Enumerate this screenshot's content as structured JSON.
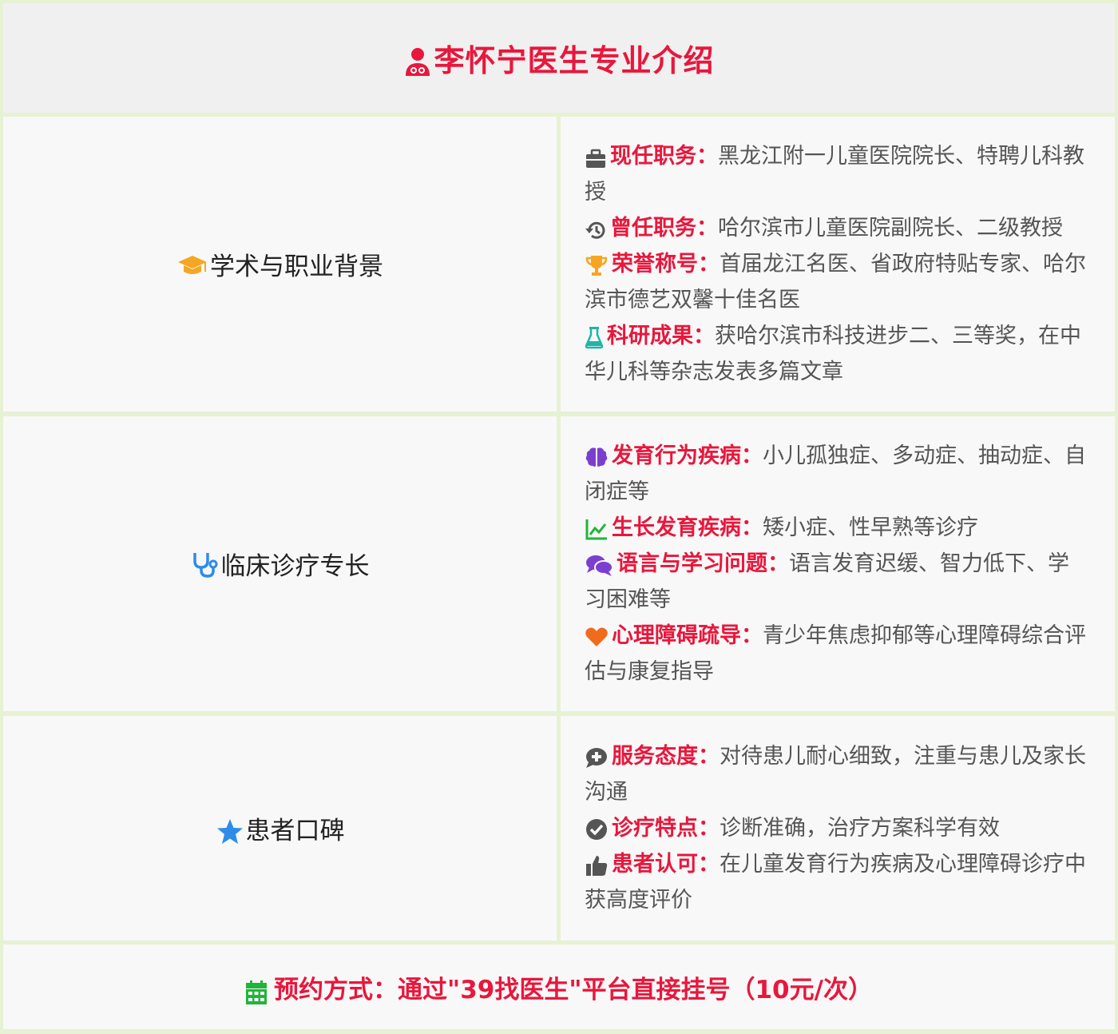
{
  "header": {
    "title": "李怀宁医生专业介绍",
    "icon": "doctor-icon",
    "color": "#e8173c"
  },
  "sections": [
    {
      "category": "学术与职业背景",
      "category_icon": "graduation-cap-icon",
      "items": [
        {
          "icon": "briefcase-icon",
          "label": "现任职务：",
          "text": "黑龙江附一儿童医院院长、特聘儿科教授"
        },
        {
          "icon": "history-icon",
          "label": "曾任职务：",
          "text": "哈尔滨市儿童医院副院长、二级教授"
        },
        {
          "icon": "trophy-icon",
          "label": "荣誉称号：",
          "text": "首届龙江名医、省政府特贴专家、哈尔滨市德艺双馨十佳名医"
        },
        {
          "icon": "flask-icon",
          "label": "科研成果：",
          "text": "获哈尔滨市科技进步二、三等奖，在中华儿科等杂志发表多篇文章"
        }
      ]
    },
    {
      "category": "临床诊疗专长",
      "category_icon": "stethoscope-icon",
      "items": [
        {
          "icon": "brain-icon",
          "label": "发育行为疾病：",
          "text": "小儿孤独症、多动症、抽动症、自闭症等"
        },
        {
          "icon": "chart-line-icon",
          "label": "生长发育疾病：",
          "text": "矮小症、性早熟等诊疗"
        },
        {
          "icon": "comments-icon",
          "label": "语言与学习问题：",
          "text": "语言发育迟缓、智力低下、学习困难等"
        },
        {
          "icon": "heart-icon",
          "label": "心理障碍疏导：",
          "text": "青少年焦虑抑郁等心理障碍综合评估与康复指导"
        }
      ]
    },
    {
      "category": "患者口碑",
      "category_icon": "star-icon",
      "items": [
        {
          "icon": "comment-medical-icon",
          "label": "服务态度：",
          "text": "对待患儿耐心细致，注重与患儿及家长沟通"
        },
        {
          "icon": "check-circle-icon",
          "label": "诊疗特点：",
          "text": "诊断准确，治疗方案科学有效"
        },
        {
          "icon": "thumbs-up-icon",
          "label": "患者认可：",
          "text": "在儿童发育行为疾病及心理障碍诊疗中获高度评价"
        }
      ]
    }
  ],
  "footer": {
    "icon": "calendar-icon",
    "text": "预约方式：通过\"39找医生\"平台直接挂号（10元/次）"
  },
  "colors": {
    "accent": "#e8173c",
    "border": "#e6f2d3",
    "header_bg": "#f0f0f0",
    "cell_bg": "#f8f8f8"
  }
}
